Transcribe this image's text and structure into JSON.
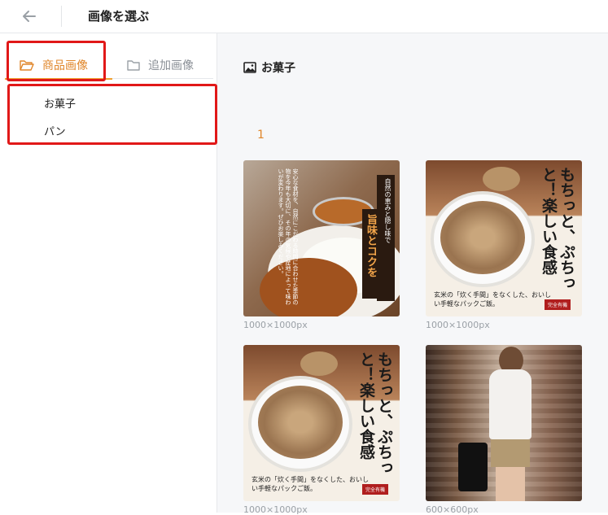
{
  "header": {
    "title": "画像を選ぶ"
  },
  "sidebar": {
    "tabs": [
      {
        "label": "商品画像",
        "active": true
      },
      {
        "label": "追加画像",
        "active": false
      }
    ],
    "categories": [
      {
        "label": "お菓子"
      },
      {
        "label": "パン"
      }
    ]
  },
  "main": {
    "section_title": "お菓子",
    "pagination": {
      "current_page": "1"
    },
    "images": [
      {
        "size": "1000×1000px",
        "text": {
          "heading": "自然の恵みと隠し味で",
          "main": "旨味とコクを",
          "body": "安心な食材を、自然にこだわる時間に合わせた季節の物を今年も大切に、その年の気候や産地によって味わいが変わります。ぜひお楽しみください。"
        }
      },
      {
        "size": "1000×1000px",
        "text": {
          "headline": "もちっと、ぷちっと！楽しい食感",
          "caption": "玄米の「炊く手間」をなくした、おいしい手軽なパックご飯。",
          "tag": "完全有機"
        }
      },
      {
        "size": "1000×1000px",
        "text": {
          "headline": "もちっと、ぷちっと！楽しい食感",
          "caption": "玄米の「炊く手間」をなくした、おいしい手軽なパックご飯。",
          "tag": "完全有機"
        }
      },
      {
        "size": "600×600px"
      }
    ]
  },
  "colors": {
    "accent": "#e0862a",
    "highlight": "#e11818",
    "muted": "#8a8f96"
  },
  "icons": [
    "back-arrow-icon",
    "folder-open-icon",
    "folder-icon",
    "image-icon"
  ]
}
